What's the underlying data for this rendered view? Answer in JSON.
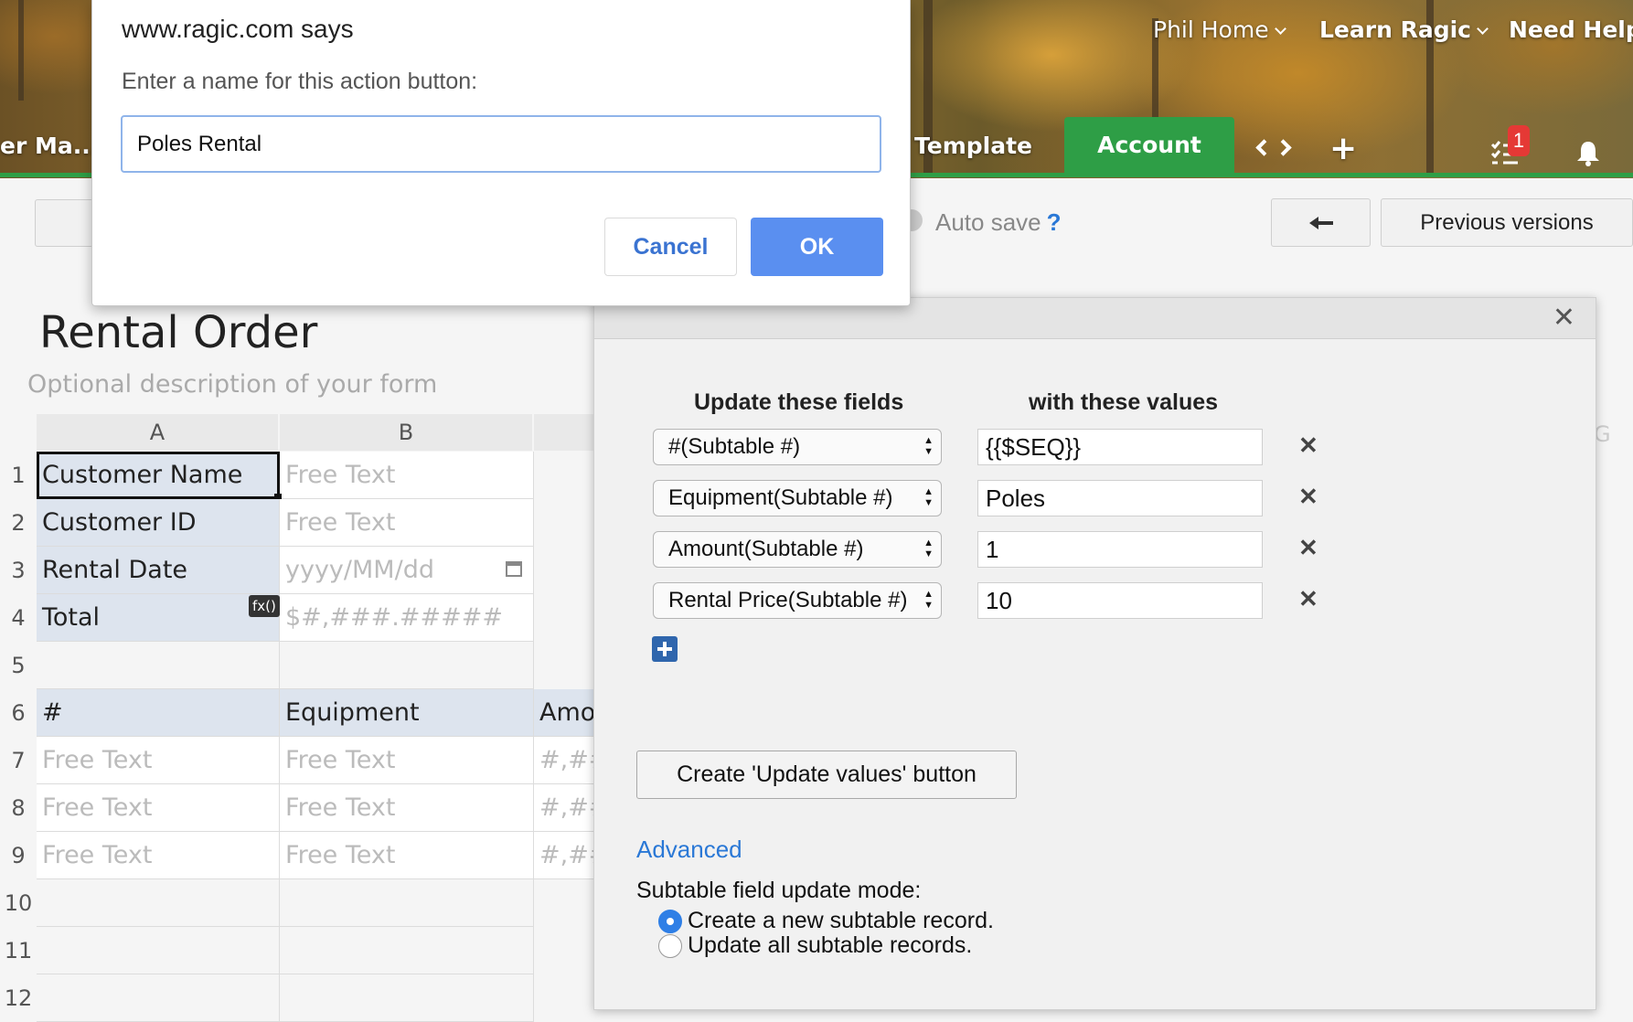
{
  "header": {
    "nav": [
      "Phil Home",
      "Learn Ragic",
      "Need Help?"
    ],
    "tab_left_partial": "er Ma...",
    "tab_template_partial": "Template",
    "tab_account": "Account",
    "notification_count": "1"
  },
  "toolbar": {
    "autosave_label": "Auto save",
    "autosave_help": "?",
    "back_icon": "arrow-left-icon",
    "previous_versions": "Previous versions"
  },
  "form": {
    "title": "Rental Order",
    "description_placeholder": "Optional description of your form"
  },
  "grid": {
    "columns": [
      "A",
      "B"
    ],
    "hidden_column_partial": "G",
    "rows": [
      "1",
      "2",
      "3",
      "4",
      "5",
      "6",
      "7",
      "8",
      "9",
      "10",
      "11",
      "12"
    ],
    "fields": [
      {
        "label": "Customer Name",
        "placeholder": "Free Text"
      },
      {
        "label": "Customer ID",
        "placeholder": "Free Text"
      },
      {
        "label": "Rental Date",
        "placeholder": "yyyy/MM/dd"
      },
      {
        "label": "Total",
        "placeholder": "$#,###.#####",
        "formula_badge": "fx()"
      }
    ],
    "subtable_headers": [
      "#",
      "Equipment",
      "Amo"
    ],
    "subtable_rows": [
      [
        "Free Text",
        "Free Text",
        "#,##"
      ],
      [
        "Free Text",
        "Free Text",
        "#,##"
      ],
      [
        "Free Text",
        "Free Text",
        "#,##"
      ]
    ]
  },
  "update_dialog": {
    "col_fields": "Update these fields",
    "col_values": "with these values",
    "rows": [
      {
        "field": "#(Subtable #)",
        "value": "{{$SEQ}}"
      },
      {
        "field": "Equipment(Subtable #)",
        "value": "Poles"
      },
      {
        "field": "Amount(Subtable #)",
        "value": "1"
      },
      {
        "field": "Rental Price(Subtable #)",
        "value": "10"
      }
    ],
    "create_button": "Create 'Update values' button",
    "advanced": "Advanced",
    "mode_label": "Subtable field update mode:",
    "mode_options": [
      "Create a new subtable record.",
      "Update all subtable records."
    ],
    "mode_selected": 0,
    "remove_glyph": "✕",
    "close_glyph": "✕"
  },
  "prompt": {
    "title": "www.ragic.com says",
    "message": "Enter a name for this action button:",
    "input_value": "Poles Rental",
    "cancel": "Cancel",
    "ok": "OK"
  }
}
